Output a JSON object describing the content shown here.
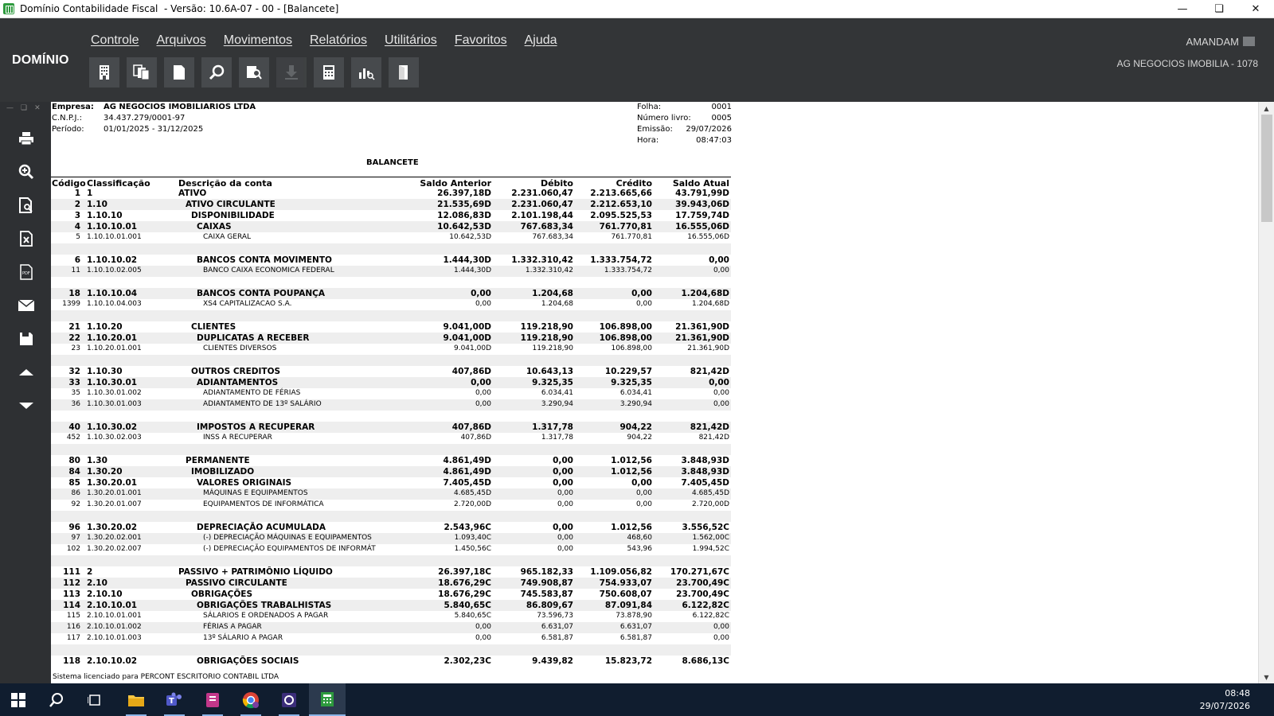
{
  "window": {
    "title": "Domínio Contabilidade Fiscal  - Versão: 10.6A-07 - 00 - [Balancete]"
  },
  "app": {
    "brand": "DOMÍNIO",
    "menu": [
      "Controle",
      "Arquivos",
      "Movimentos",
      "Relatórios",
      "Utilitários",
      "Favoritos",
      "Ajuda"
    ],
    "toolbar_icons": [
      "building-icon",
      "copy-docs-icon",
      "document-icon",
      "search-icon",
      "search-document-icon",
      "download-icon",
      "calculator-icon",
      "chart-search-icon",
      "door-exit-icon"
    ],
    "user": "AMANDAM",
    "company": "AG NEGOCIOS IMOBILIA - 1078"
  },
  "sidebar_icons": [
    "print-icon",
    "zoom-icon",
    "preview-icon",
    "excel-icon",
    "pdf-icon",
    "email-icon",
    "save-icon",
    "arrow-up-icon",
    "arrow-down-icon"
  ],
  "report": {
    "empresa_label": "Empresa:",
    "empresa": "AG NEGOCIOS IMOBILIARIOS LTDA",
    "cnpj_label": "C.N.P.J.:",
    "cnpj": "34.437.279/0001-97",
    "periodo_label": "Período:",
    "periodo": "01/01/2025 - 31/12/2025",
    "folha_label": "Folha:",
    "folha": "0001",
    "livro_label": "Número livro:",
    "livro": "0005",
    "emissao_label": "Emissão:",
    "emissao": "29/07/2026",
    "hora_label": "Hora:",
    "hora": "08:47:03",
    "title": "BALANCETE",
    "columns": {
      "codigo": "Código",
      "classificacao": "Classificação",
      "descricao": "Descrição da conta",
      "saldo_anterior": "Saldo Anterior",
      "debito": "Débito",
      "credito": "Crédito",
      "saldo_atual": "Saldo Atual"
    },
    "rows": [
      {
        "code": "1",
        "class": "1",
        "desc": "ATIVO",
        "indent": 0,
        "bold": true,
        "sa": "26.397,18D",
        "deb": "2.231.060,47",
        "cred": "2.213.665,66",
        "sat": "43.791,99D"
      },
      {
        "code": "2",
        "class": "1.10",
        "desc": "ATIVO CIRCULANTE",
        "indent": 1,
        "bold": true,
        "sa": "21.535,69D",
        "deb": "2.231.060,47",
        "cred": "2.212.653,10",
        "sat": "39.943,06D"
      },
      {
        "code": "3",
        "class": "1.10.10",
        "desc": "DISPONIBILIDADE",
        "indent": 2,
        "bold": true,
        "sa": "12.086,83D",
        "deb": "2.101.198,44",
        "cred": "2.095.525,53",
        "sat": "17.759,74D"
      },
      {
        "code": "4",
        "class": "1.10.10.01",
        "desc": "CAIXAS",
        "indent": 3,
        "bold": true,
        "sa": "10.642,53D",
        "deb": "767.683,34",
        "cred": "761.770,81",
        "sat": "16.555,06D"
      },
      {
        "code": "5",
        "class": "1.10.10.01.001",
        "desc": "CAIXA GERAL",
        "indent": 4,
        "bold": false,
        "sa": "10.642,53D",
        "deb": "767.683,34",
        "cred": "761.770,81",
        "sat": "16.555,06D"
      },
      {
        "blank": true
      },
      {
        "code": "6",
        "class": "1.10.10.02",
        "desc": "BANCOS CONTA MOVIMENTO",
        "indent": 3,
        "bold": true,
        "sa": "1.444,30D",
        "deb": "1.332.310,42",
        "cred": "1.333.754,72",
        "sat": "0,00"
      },
      {
        "code": "11",
        "class": "1.10.10.02.005",
        "desc": "BANCO CAIXA ECONOMICA FEDERAL",
        "indent": 4,
        "bold": false,
        "sa": "1.444,30D",
        "deb": "1.332.310,42",
        "cred": "1.333.754,72",
        "sat": "0,00"
      },
      {
        "blank": true
      },
      {
        "code": "18",
        "class": "1.10.10.04",
        "desc": "BANCOS CONTA POUPANÇA",
        "indent": 3,
        "bold": true,
        "sa": "0,00",
        "deb": "1.204,68",
        "cred": "0,00",
        "sat": "1.204,68D"
      },
      {
        "code": "1399",
        "class": "1.10.10.04.003",
        "desc": "XS4 CAPITALIZACAO S.A.",
        "indent": 4,
        "bold": false,
        "sa": "0,00",
        "deb": "1.204,68",
        "cred": "0,00",
        "sat": "1.204,68D"
      },
      {
        "blank": true
      },
      {
        "code": "21",
        "class": "1.10.20",
        "desc": "CLIENTES",
        "indent": 2,
        "bold": true,
        "sa": "9.041,00D",
        "deb": "119.218,90",
        "cred": "106.898,00",
        "sat": "21.361,90D"
      },
      {
        "code": "22",
        "class": "1.10.20.01",
        "desc": "DUPLICATAS A RECEBER",
        "indent": 3,
        "bold": true,
        "sa": "9.041,00D",
        "deb": "119.218,90",
        "cred": "106.898,00",
        "sat": "21.361,90D"
      },
      {
        "code": "23",
        "class": "1.10.20.01.001",
        "desc": "CLIENTES DIVERSOS",
        "indent": 4,
        "bold": false,
        "sa": "9.041,00D",
        "deb": "119.218,90",
        "cred": "106.898,00",
        "sat": "21.361,90D"
      },
      {
        "blank": true
      },
      {
        "code": "32",
        "class": "1.10.30",
        "desc": "OUTROS CREDITOS",
        "indent": 2,
        "bold": true,
        "sa": "407,86D",
        "deb": "10.643,13",
        "cred": "10.229,57",
        "sat": "821,42D"
      },
      {
        "code": "33",
        "class": "1.10.30.01",
        "desc": "ADIANTAMENTOS",
        "indent": 3,
        "bold": true,
        "sa": "0,00",
        "deb": "9.325,35",
        "cred": "9.325,35",
        "sat": "0,00"
      },
      {
        "code": "35",
        "class": "1.10.30.01.002",
        "desc": "ADIANTAMENTO DE FÉRIAS",
        "indent": 4,
        "bold": false,
        "sa": "0,00",
        "deb": "6.034,41",
        "cred": "6.034,41",
        "sat": "0,00"
      },
      {
        "code": "36",
        "class": "1.10.30.01.003",
        "desc": "ADIANTAMENTO DE 13º SALÁRIO",
        "indent": 4,
        "bold": false,
        "sa": "0,00",
        "deb": "3.290,94",
        "cred": "3.290,94",
        "sat": "0,00"
      },
      {
        "blank": true
      },
      {
        "code": "40",
        "class": "1.10.30.02",
        "desc": "IMPOSTOS A RECUPERAR",
        "indent": 3,
        "bold": true,
        "sa": "407,86D",
        "deb": "1.317,78",
        "cred": "904,22",
        "sat": "821,42D"
      },
      {
        "code": "452",
        "class": "1.10.30.02.003",
        "desc": "INSS A RECUPERAR",
        "indent": 4,
        "bold": false,
        "sa": "407,86D",
        "deb": "1.317,78",
        "cred": "904,22",
        "sat": "821,42D"
      },
      {
        "blank": true
      },
      {
        "code": "80",
        "class": "1.30",
        "desc": "PERMANENTE",
        "indent": 1,
        "bold": true,
        "sa": "4.861,49D",
        "deb": "0,00",
        "cred": "1.012,56",
        "sat": "3.848,93D"
      },
      {
        "code": "84",
        "class": "1.30.20",
        "desc": "IMOBILIZADO",
        "indent": 2,
        "bold": true,
        "sa": "4.861,49D",
        "deb": "0,00",
        "cred": "1.012,56",
        "sat": "3.848,93D"
      },
      {
        "code": "85",
        "class": "1.30.20.01",
        "desc": "VALORES ORIGINAIS",
        "indent": 3,
        "bold": true,
        "sa": "7.405,45D",
        "deb": "0,00",
        "cred": "0,00",
        "sat": "7.405,45D"
      },
      {
        "code": "86",
        "class": "1.30.20.01.001",
        "desc": "MÁQUINAS E EQUIPAMENTOS",
        "indent": 4,
        "bold": false,
        "sa": "4.685,45D",
        "deb": "0,00",
        "cred": "0,00",
        "sat": "4.685,45D"
      },
      {
        "code": "92",
        "class": "1.30.20.01.007",
        "desc": "EQUIPAMENTOS DE INFORMÁTICA",
        "indent": 4,
        "bold": false,
        "sa": "2.720,00D",
        "deb": "0,00",
        "cred": "0,00",
        "sat": "2.720,00D"
      },
      {
        "blank": true
      },
      {
        "code": "96",
        "class": "1.30.20.02",
        "desc": "DEPRECIAÇÃO ACUMULADA",
        "indent": 3,
        "bold": true,
        "sa": "2.543,96C",
        "deb": "0,00",
        "cred": "1.012,56",
        "sat": "3.556,52C"
      },
      {
        "code": "97",
        "class": "1.30.20.02.001",
        "desc": "(-) DEPRECIAÇÃO MÁQUINAS E EQUIPAMENTOS",
        "indent": 4,
        "bold": false,
        "sa": "1.093,40C",
        "deb": "0,00",
        "cred": "468,60",
        "sat": "1.562,00C"
      },
      {
        "code": "102",
        "class": "1.30.20.02.007",
        "desc": "(-) DEPRECIAÇÃO EQUIPAMENTOS DE INFORMÁT",
        "indent": 4,
        "bold": false,
        "sa": "1.450,56C",
        "deb": "0,00",
        "cred": "543,96",
        "sat": "1.994,52C"
      },
      {
        "blank": true
      },
      {
        "code": "111",
        "class": "2",
        "desc": "PASSIVO + PATRIMÔNIO LÍQUIDO",
        "indent": 0,
        "bold": true,
        "sa": "26.397,18C",
        "deb": "965.182,33",
        "cred": "1.109.056,82",
        "sat": "170.271,67C"
      },
      {
        "code": "112",
        "class": "2.10",
        "desc": "PASSIVO CIRCULANTE",
        "indent": 1,
        "bold": true,
        "sa": "18.676,29C",
        "deb": "749.908,87",
        "cred": "754.933,07",
        "sat": "23.700,49C"
      },
      {
        "code": "113",
        "class": "2.10.10",
        "desc": "OBRIGAÇÕES",
        "indent": 2,
        "bold": true,
        "sa": "18.676,29C",
        "deb": "745.583,87",
        "cred": "750.608,07",
        "sat": "23.700,49C"
      },
      {
        "code": "114",
        "class": "2.10.10.01",
        "desc": "OBRIGAÇÕES TRABALHISTAS",
        "indent": 3,
        "bold": true,
        "sa": "5.840,65C",
        "deb": "86.809,67",
        "cred": "87.091,84",
        "sat": "6.122,82C"
      },
      {
        "code": "115",
        "class": "2.10.10.01.001",
        "desc": "SÁLARIOS E ORDENADOS A PAGAR",
        "indent": 4,
        "bold": false,
        "sa": "5.840,65C",
        "deb": "73.596,73",
        "cred": "73.878,90",
        "sat": "6.122,82C"
      },
      {
        "code": "116",
        "class": "2.10.10.01.002",
        "desc": "FÉRIAS A PAGAR",
        "indent": 4,
        "bold": false,
        "sa": "0,00",
        "deb": "6.631,07",
        "cred": "6.631,07",
        "sat": "0,00"
      },
      {
        "code": "117",
        "class": "2.10.10.01.003",
        "desc": "13º SÁLARIO A PAGAR",
        "indent": 4,
        "bold": false,
        "sa": "0,00",
        "deb": "6.581,87",
        "cred": "6.581,87",
        "sat": "0,00"
      },
      {
        "blank": true
      },
      {
        "code": "118",
        "class": "2.10.10.02",
        "desc": "OBRIGAÇÕES SOCIAIS",
        "indent": 3,
        "bold": true,
        "sa": "2.302,23C",
        "deb": "9.439,82",
        "cred": "15.823,72",
        "sat": "8.686,13C"
      }
    ],
    "license": "Sistema licenciado para PERCONT ESCRITORIO CONTABIL LTDA"
  },
  "taskbar": {
    "apps": [
      "start-icon",
      "search-icon",
      "task-view-icon",
      "file-explorer-icon",
      "teams-icon",
      "notes-app-icon",
      "chrome-icon",
      "dominio-helper-icon",
      "dominio-app-icon"
    ],
    "time": "08:48",
    "date": "29/07/2026"
  }
}
